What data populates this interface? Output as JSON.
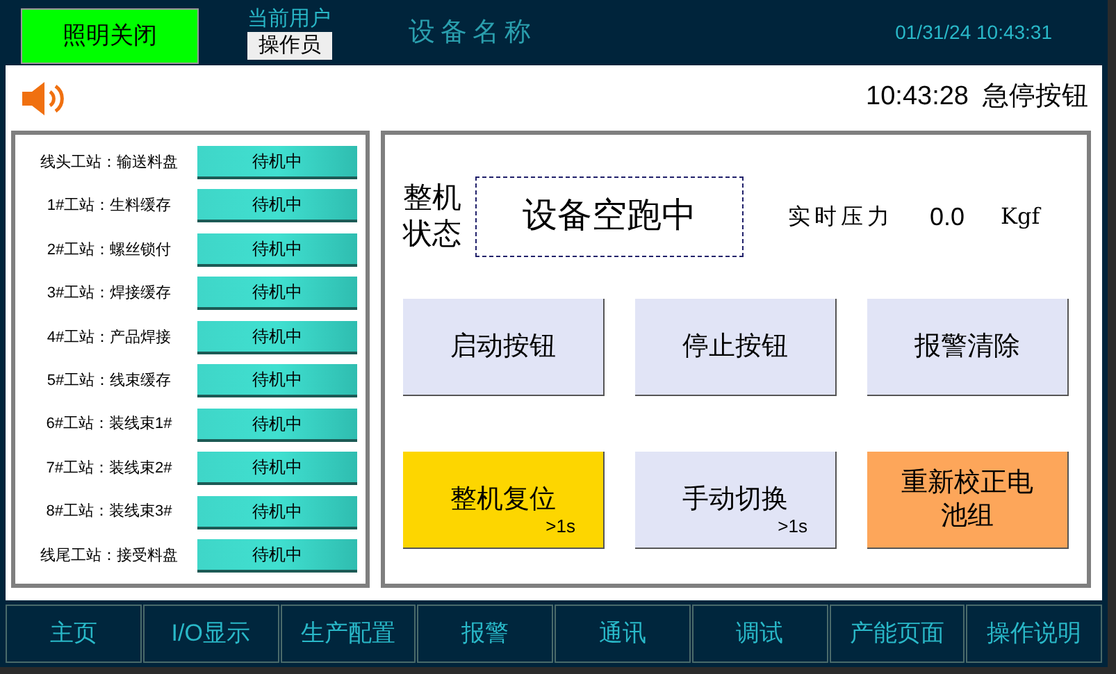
{
  "header": {
    "light_button": "照明关闭",
    "user_label": "当前用户",
    "user": "操作员",
    "device_name": "设备名称",
    "datetime": "01/31/24 10:43:31"
  },
  "alarm_bar": {
    "time": "10:43:28",
    "message": "急停按钮"
  },
  "stations": [
    {
      "name": "线头工站：输送料盘",
      "status": "待机中"
    },
    {
      "name": "1#工站：生料缓存",
      "status": "待机中"
    },
    {
      "name": "2#工站：螺丝锁付",
      "status": "待机中"
    },
    {
      "name": "3#工站：焊接缓存",
      "status": "待机中"
    },
    {
      "name": "4#工站：产品焊接",
      "status": "待机中"
    },
    {
      "name": "5#工站：线束缓存",
      "status": "待机中"
    },
    {
      "name": "6#工站：装线束1#",
      "status": "待机中"
    },
    {
      "name": "7#工站：装线束2#",
      "status": "待机中"
    },
    {
      "name": "8#工站：装线束3#",
      "status": "待机中"
    },
    {
      "name": "线尾工站：接受料盘",
      "status": "待机中"
    }
  ],
  "machine_status": {
    "label": "整机状态",
    "value": "设备空跑中"
  },
  "pressure": {
    "label": "实时压力",
    "value": "0.0",
    "unit": "Kgf"
  },
  "buttons": [
    {
      "label": "启动按钮",
      "color": "#e1e4f6"
    },
    {
      "label": "停止按钮",
      "color": "#e1e4f6"
    },
    {
      "label": "报警清除",
      "color": "#e1e4f6"
    },
    {
      "label": "整机复位",
      "note": ">1s",
      "color": "#fdd600"
    },
    {
      "label": "手动切换",
      "note": ">1s",
      "color": "#e1e4f6"
    },
    {
      "label": "重新校正电池组",
      "color": "#fda65a"
    }
  ],
  "nav": [
    {
      "label": "主页"
    },
    {
      "label": "I/O显示"
    },
    {
      "label": "生产配置"
    },
    {
      "label": "报警"
    },
    {
      "label": "通讯"
    },
    {
      "label": "调试"
    },
    {
      "label": "产能页面"
    },
    {
      "label": "操作说明"
    }
  ]
}
